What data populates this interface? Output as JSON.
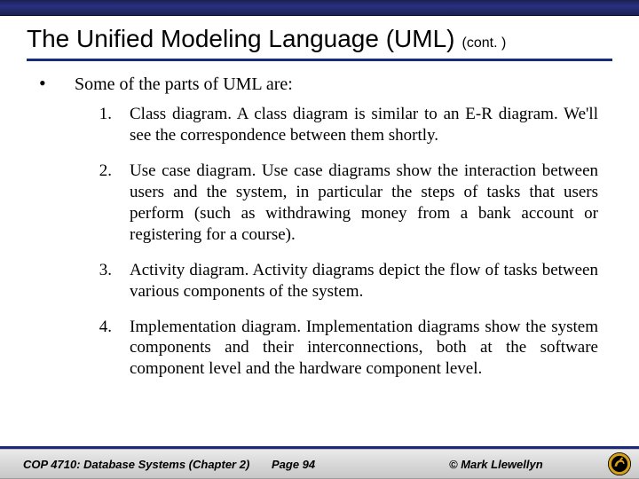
{
  "header": {
    "title": "The Unified Modeling Language (UML)",
    "continuation": "(cont. )"
  },
  "intro": "Some of the parts of UML are:",
  "items": [
    {
      "num": "1.",
      "text": "Class diagram.  A class diagram is similar to an E-R diagram.  We'll see the correspondence between them shortly."
    },
    {
      "num": "2.",
      "text": "Use case diagram. Use case diagrams show the  interaction between users and the system, in particular the steps of tasks that users perform (such as withdrawing money from a bank account or registering for a course)."
    },
    {
      "num": "3.",
      "text": "Activity diagram.  Activity diagrams depict the flow of tasks between various components of the system."
    },
    {
      "num": "4.",
      "text": "Implementation diagram.  Implementation diagrams show the system components and their interconnections, both at the software component level and the hardware component level."
    }
  ],
  "footer": {
    "course": "COP 4710: Database Systems  (Chapter 2)",
    "page": "Page 94",
    "copyright": "© Mark Llewellyn"
  }
}
